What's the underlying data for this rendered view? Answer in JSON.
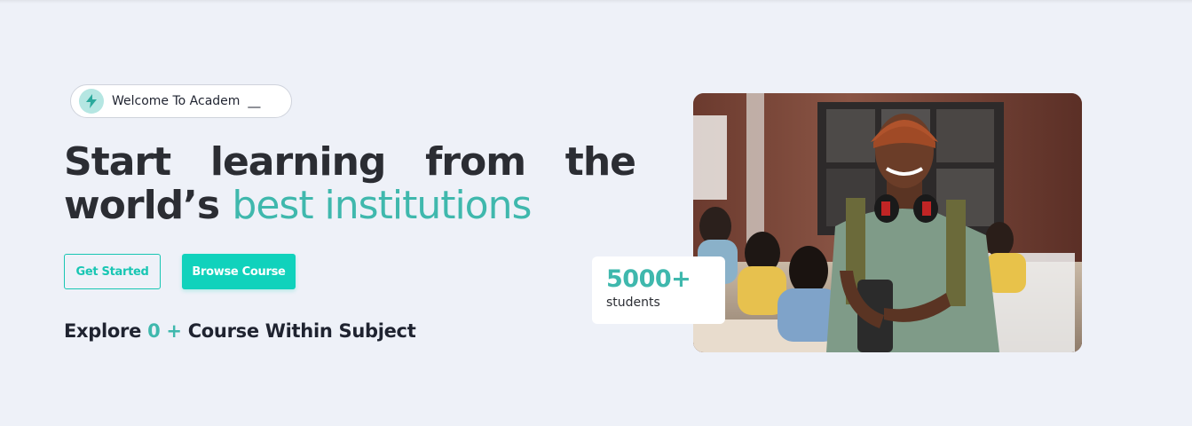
{
  "welcome": {
    "text": "Welcome To Academ  __",
    "icon": "lightning-icon"
  },
  "hero": {
    "title_line1_words": [
      "Start",
      "learning",
      "from",
      "the"
    ],
    "title_line2_plain": "world’s ",
    "title_line2_accent": "best institutions"
  },
  "buttons": {
    "get_started": "Get Started",
    "browse_course": "Browse Course"
  },
  "explore": {
    "prefix": "Explore ",
    "count": "0 +",
    "suffix": " Course Within Subject"
  },
  "stat": {
    "value": "5000+",
    "label": "students"
  },
  "colors": {
    "accent": "#3fb8ad",
    "button": "#10d2bc",
    "background": "#eef1f8",
    "text": "#2b2d33"
  }
}
